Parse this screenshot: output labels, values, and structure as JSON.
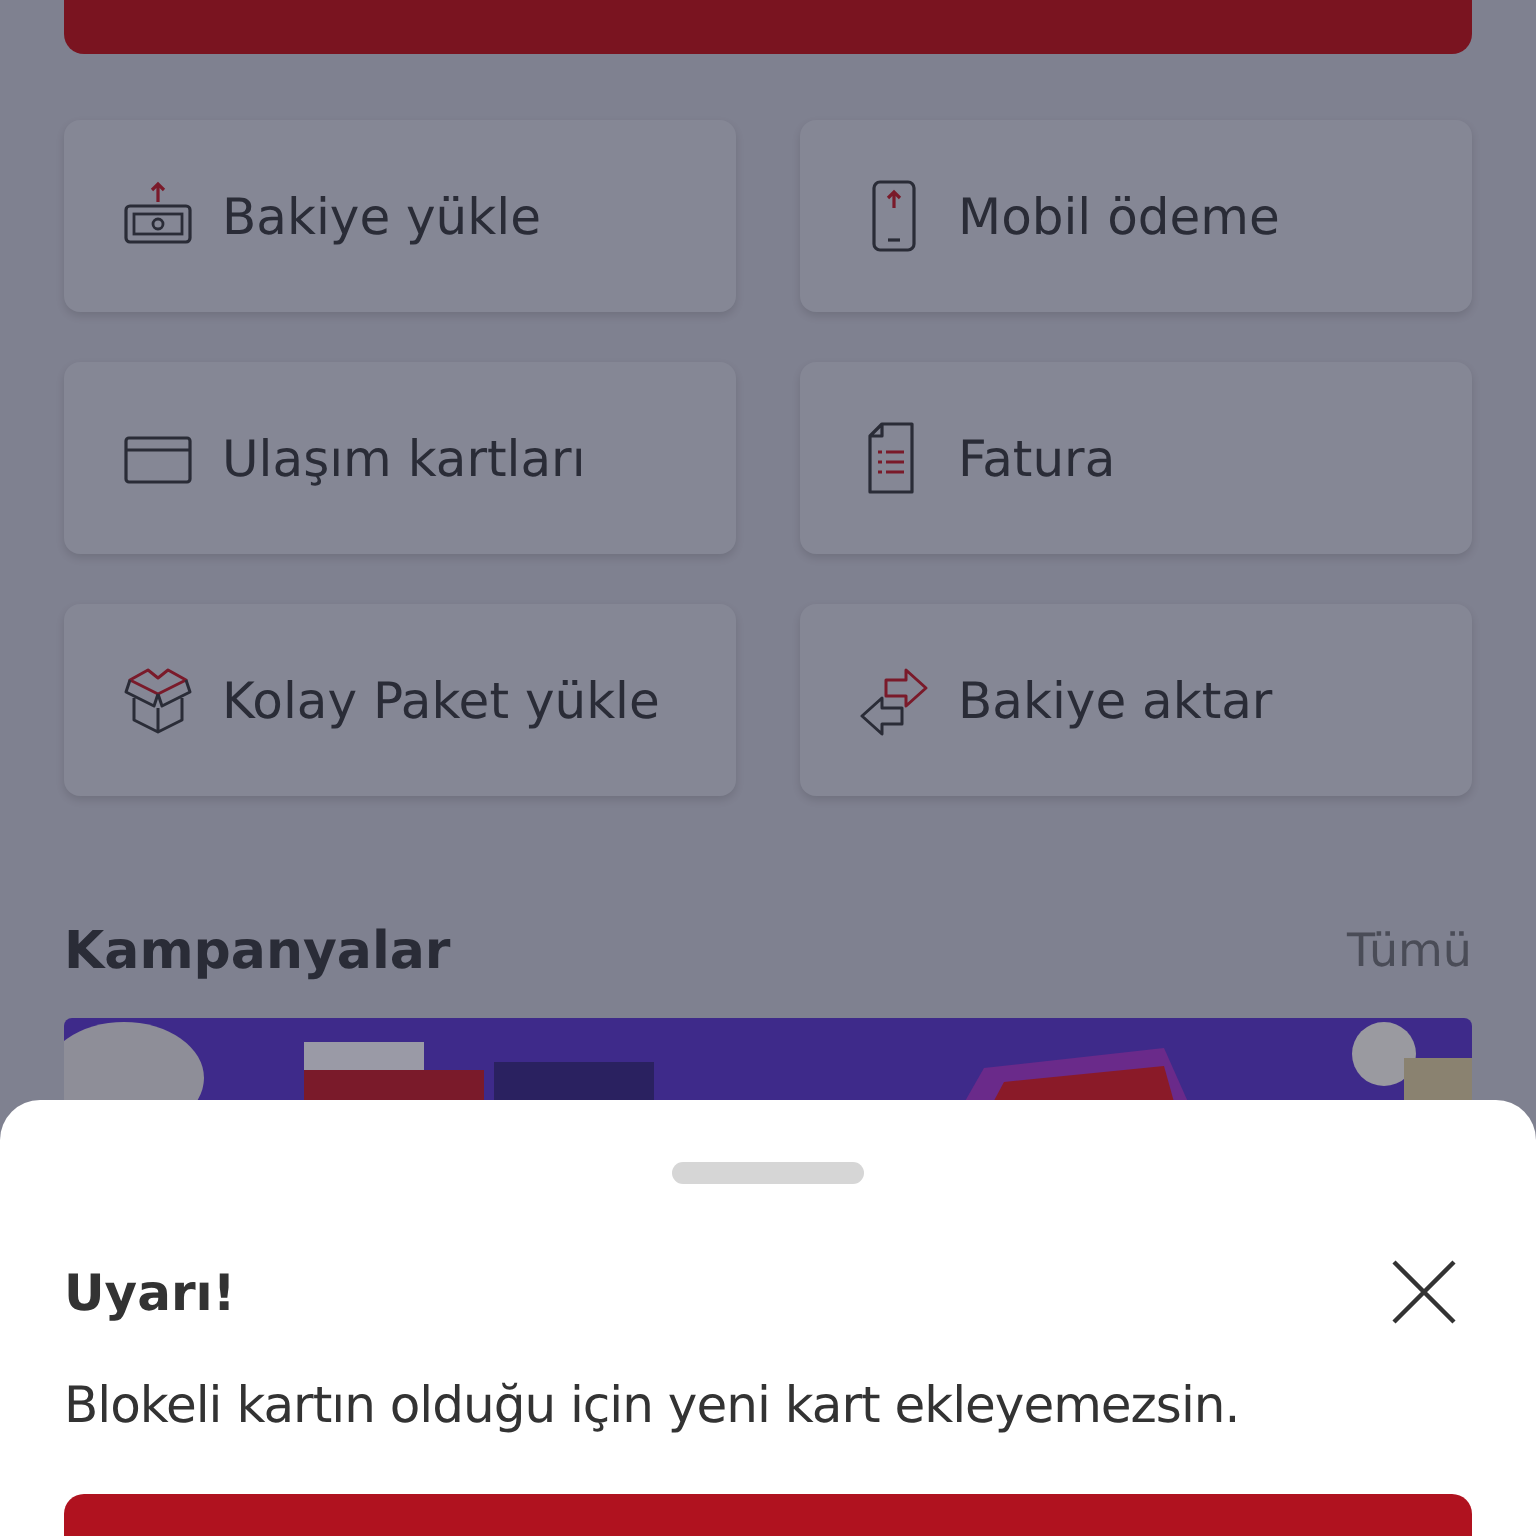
{
  "tiles": [
    {
      "label": "Bakiye yükle",
      "kind": "cash"
    },
    {
      "label": "Mobil ödeme",
      "kind": "phone"
    },
    {
      "label": "Ulaşım kartları",
      "kind": "card"
    },
    {
      "label": "Fatura",
      "kind": "bill"
    },
    {
      "label": "Kolay Paket yükle",
      "kind": "box"
    },
    {
      "label": "Bakiye aktar",
      "kind": "transfer"
    }
  ],
  "campaigns": {
    "title": "Kampanyalar",
    "see_all": "Tümü"
  },
  "sheet": {
    "title": "Uyarı!",
    "message": "Blokeli kartın olduğu için yeni kart ekleyemezsin."
  }
}
